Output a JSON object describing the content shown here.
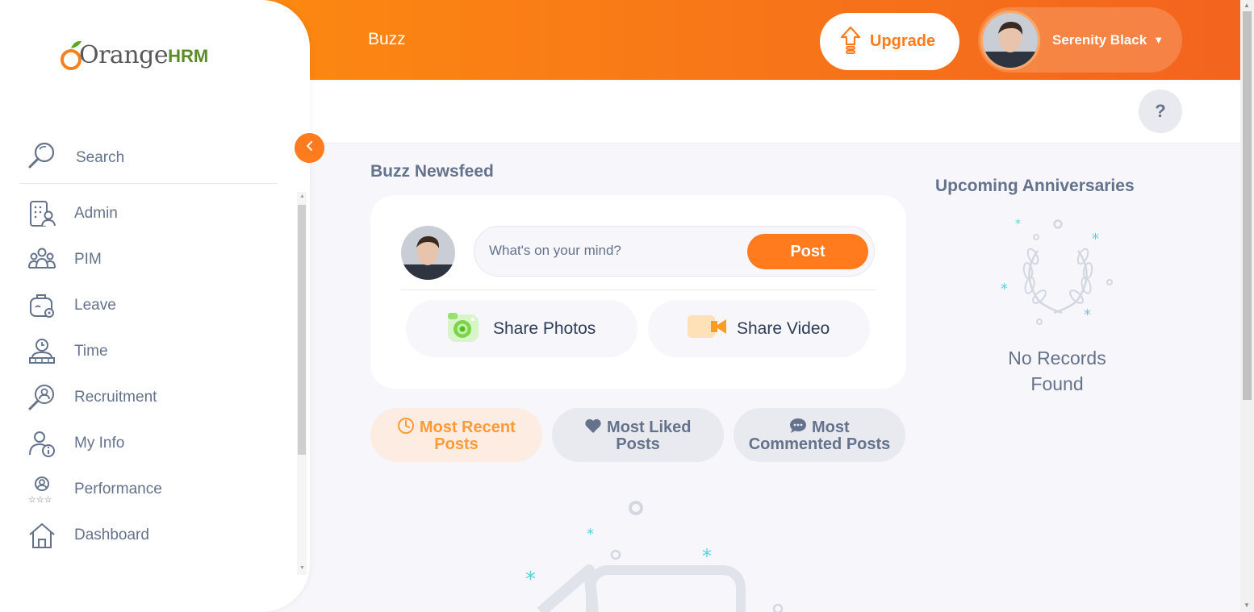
{
  "header": {
    "page_title": "Buzz",
    "upgrade_label": "Upgrade",
    "user_name": "Serenity Black",
    "help_label": "?"
  },
  "sidebar": {
    "logo_text": "Orange",
    "logo_suffix": "HRM",
    "search_label": "Search",
    "items": [
      {
        "label": "Admin",
        "icon": "admin-icon"
      },
      {
        "label": "PIM",
        "icon": "pim-icon"
      },
      {
        "label": "Leave",
        "icon": "leave-icon"
      },
      {
        "label": "Time",
        "icon": "time-icon"
      },
      {
        "label": "Recruitment",
        "icon": "recruitment-icon"
      },
      {
        "label": "My Info",
        "icon": "my-info-icon"
      },
      {
        "label": "Performance",
        "icon": "performance-icon"
      },
      {
        "label": "Dashboard",
        "icon": "dashboard-icon"
      }
    ]
  },
  "feed": {
    "title": "Buzz Newsfeed",
    "input_placeholder": "What's on your mind?",
    "post_label": "Post",
    "share_photos_label": "Share Photos",
    "share_video_label": "Share Video",
    "tabs": [
      {
        "line1": "Most Recent",
        "line2": "Posts",
        "active": true
      },
      {
        "line1": "Most Liked",
        "line2": "Posts",
        "active": false
      },
      {
        "line1": "Most",
        "line2": "Commented Posts",
        "active": false
      }
    ]
  },
  "anniversaries": {
    "title": "Upcoming Anniversaries",
    "empty_line1": "No Records",
    "empty_line2": "Found"
  },
  "colors": {
    "accent": "#ff7b1d",
    "header_start": "#ff920b",
    "header_end": "#f3641e",
    "text": "#64728c",
    "teal": "#5bd2e0"
  }
}
